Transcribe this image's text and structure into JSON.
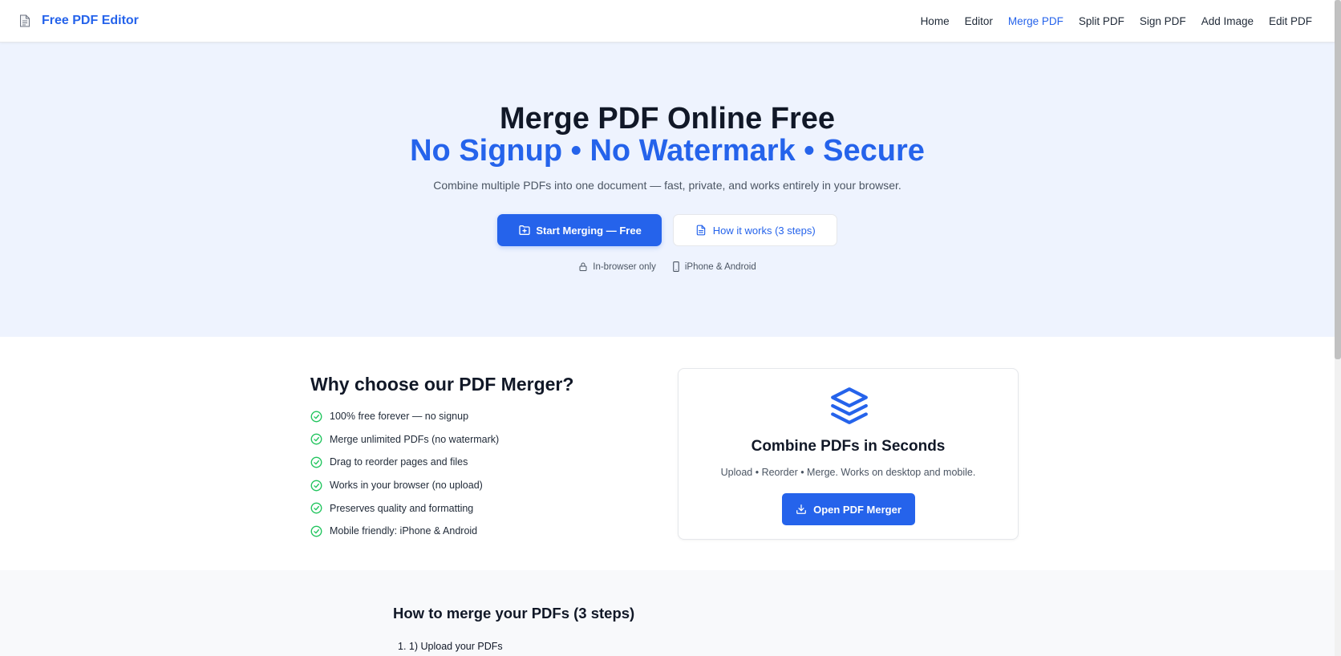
{
  "nav": {
    "brand": "Free PDF Editor",
    "links": [
      {
        "label": "Home"
      },
      {
        "label": "Editor"
      },
      {
        "label": "Merge PDF",
        "active": true
      },
      {
        "label": "Split PDF"
      },
      {
        "label": "Sign PDF"
      },
      {
        "label": "Add Image"
      },
      {
        "label": "Edit PDF"
      }
    ]
  },
  "hero": {
    "title": "Merge PDF Online Free",
    "subtitle": "No Signup • No Watermark • Secure",
    "description": "Combine multiple PDFs into one document — fast, private, and works entirely in your browser.",
    "primary_button": "Start Merging — Free",
    "secondary_button": "How it works (3 steps)",
    "badges": [
      {
        "icon": "lock-icon",
        "label": "In-browser only"
      },
      {
        "icon": "phone-icon",
        "label": "iPhone & Android"
      }
    ]
  },
  "features": {
    "title": "Why choose our PDF Merger?",
    "items": [
      "100% free forever — no signup",
      "Merge unlimited PDFs (no watermark)",
      "Drag to reorder pages and files",
      "Works in your browser (no upload)",
      "Preserves quality and formatting",
      "Mobile friendly: iPhone & Android"
    ],
    "card": {
      "icon": "layers-icon",
      "title": "Combine PDFs in Seconds",
      "description": "Upload • Reorder • Merge. Works on desktop and mobile.",
      "button": "Open PDF Merger"
    }
  },
  "steps": {
    "title": "How to merge your PDFs (3 steps)",
    "items": [
      "1. 1) Upload your PDFs"
    ]
  },
  "colors": {
    "accent": "#2563eb",
    "hero_bg": "#eef3fe",
    "check": "#22c55e"
  }
}
